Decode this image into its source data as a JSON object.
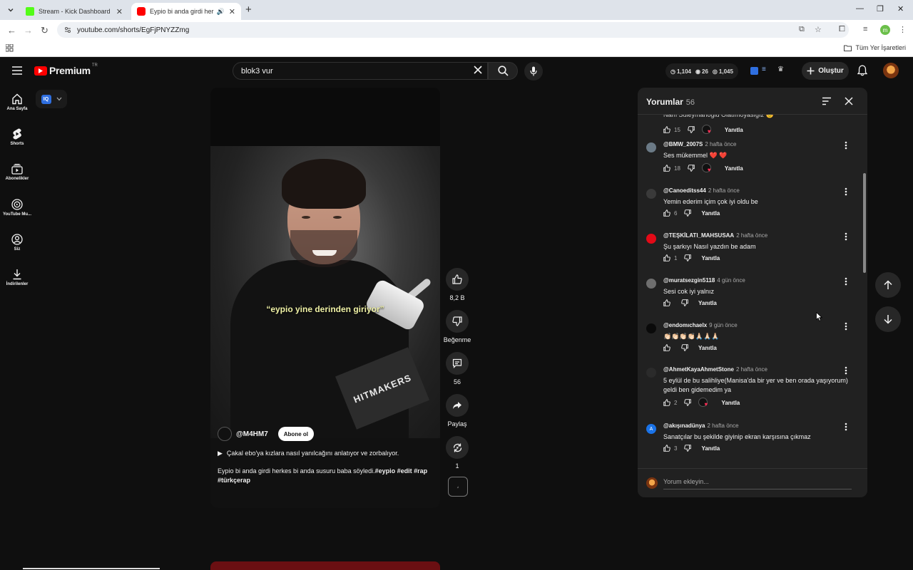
{
  "browser": {
    "tabs": [
      {
        "title": "Stream - Kick Dashboard",
        "favicon_color": "#53fc18"
      },
      {
        "title": "Eypio bi anda girdi herkes b",
        "favicon_color": "#ff0000"
      }
    ],
    "url": "youtube.com/shorts/EgFjPNYZZmg",
    "bookmarks_label": "Tüm Yer İşaretleri",
    "profile_initial": "m"
  },
  "header": {
    "logo_text": "Premium",
    "country_code": "TR",
    "search_value": "blok3 vur",
    "stats": {
      "watch": "1,104",
      "views": "26",
      "other": "1,045"
    },
    "create_label": "Oluştur"
  },
  "sidebar": {
    "items": [
      {
        "label": "Ana Sayfa",
        "icon": "home-icon"
      },
      {
        "label": "Shorts",
        "icon": "shorts-icon"
      },
      {
        "label": "Abonelikler",
        "icon": "subscriptions-icon"
      },
      {
        "label": "YouTube Mu...",
        "icon": "music-icon"
      },
      {
        "label": "Siz",
        "icon": "account-icon"
      },
      {
        "label": "İndirilenler",
        "icon": "download-icon"
      }
    ]
  },
  "extension": {
    "badge": "IQ"
  },
  "short": {
    "caption": "“eypio yine derinden giriyor”",
    "box_text": "HITMAKERS",
    "channel": "@M4HM7",
    "subscribe_label": "Abone ol",
    "suggestion": "Çakal ebo'ya kızlara nasıl yanılcağını anlatıyor ve zorbalıyor.",
    "description_text": "Eypio bi anda girdi herkes bi anda susuru baba söyledi.",
    "description_tags": "#eypio #edit #rap #türkçerap",
    "actions": {
      "like_count": "8,2 B",
      "dislike_label": "Beğenme",
      "comment_count": "56",
      "share_label": "Paylaş",
      "remix_count": "1"
    }
  },
  "comments": {
    "title": "Yorumlar",
    "count": "56",
    "partial_text": "Nam Süleymanoglu Olatımoyasıgız 😊",
    "partial_likes": "15",
    "reply_label": "Yanıtla",
    "input_placeholder": "Yorum ekleyin...",
    "items": [
      {
        "user": "@BMW_2007S",
        "time": "2 hafta önce",
        "text": "Ses mükemmel ❤️ ❤️",
        "likes": "18",
        "hearted": true,
        "avatar_color": "#6b7a86"
      },
      {
        "user": "@Canoeditss44",
        "time": "2 hafta önce",
        "text": "Yemin ederim içim çok iyi oldu be",
        "likes": "6",
        "hearted": false,
        "avatar_color": "#3a3a3a"
      },
      {
        "user": "@TEŞKİLATI_MAHSUSAA",
        "time": "2 hafta önce",
        "text": "Şu şarkıyı Nasıl yazdın be adam",
        "likes": "1",
        "hearted": false,
        "avatar_color": "#e30a17"
      },
      {
        "user": "@muratsezgin5118",
        "time": "4 gün önce",
        "text": "Sesi cok iyi yalnız",
        "likes": "",
        "hearted": false,
        "avatar_color": "#6e6e6e"
      },
      {
        "user": "@endomıchaelx",
        "time": "9 gün önce",
        "text": "👏🏻👏🏻👏🏻👏🏻🙏🏻🙏🏻🙏🏻",
        "likes": "",
        "hearted": false,
        "avatar_color": "#0a0a0a"
      },
      {
        "user": "@AhmetKayaAhmetStone",
        "time": "2 hafta önce",
        "text": "5 eylül de bu salihliye(Manisa'da bir yer ve ben orada yaşıyorum) geldi ben gidemedim ya",
        "likes": "2",
        "hearted": true,
        "avatar_color": "#2b2b2b"
      },
      {
        "user": "@akışınadünya",
        "time": "2 hafta önce",
        "text": "Sanatçılar bu şekilde giyinip ekran karşısına çıkmaz",
        "likes": "3",
        "hearted": false,
        "avatar_color": "#1a73e8",
        "avatar_letter": "A"
      }
    ]
  }
}
